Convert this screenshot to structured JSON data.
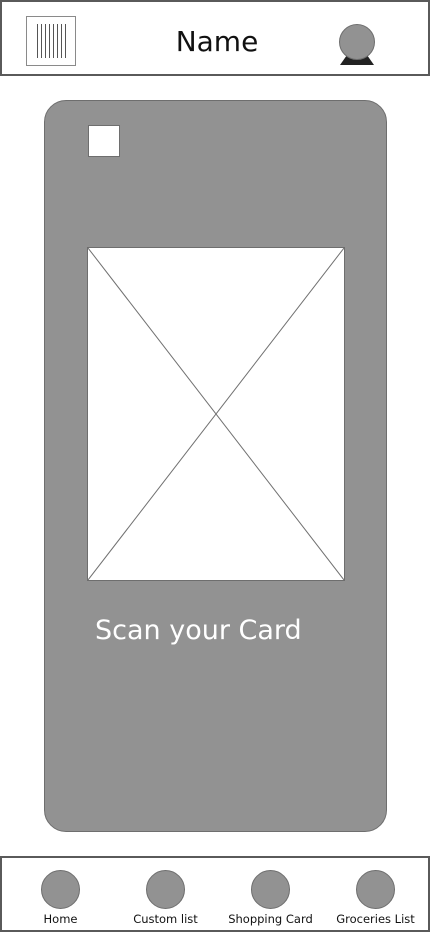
{
  "header": {
    "title": "Name",
    "left_icon": "barcode-icon",
    "right_icon": "user-avatar-icon"
  },
  "card": {
    "checkbox_icon": "checkbox-icon",
    "image_placeholder": "image-placeholder-icon",
    "label": "Scan your Card",
    "background_color": "#929292"
  },
  "bottom_nav": {
    "items": [
      {
        "label": "Home",
        "icon": "circle-icon"
      },
      {
        "label": "Custom list",
        "icon": "circle-icon"
      },
      {
        "label": "Shopping Card",
        "icon": "circle-icon"
      },
      {
        "label": "Groceries List",
        "icon": "circle-icon"
      }
    ]
  }
}
